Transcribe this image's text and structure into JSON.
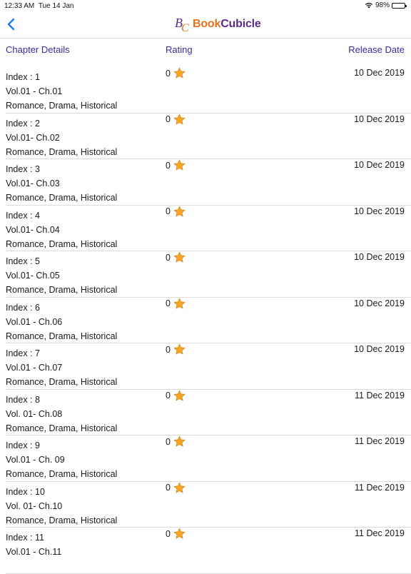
{
  "status_bar": {
    "time": "12:33 AM",
    "date": "Tue 14 Jan",
    "battery": "98%",
    "battery_level": 0.98
  },
  "nav": {
    "back_icon": "chevron-left-icon",
    "logo_mark": "BC",
    "logo_book": "Book",
    "logo_cubicle": "Cubicle"
  },
  "header": {
    "chapter_details": "Chapter Details",
    "rating": "Rating",
    "release_date": "Release Date"
  },
  "colors": {
    "accent": "#3e2aa0",
    "back": "#1a7cf5",
    "logo_orange": "#e8721c",
    "logo_purple": "#5b2b8e",
    "star": "#f6a623"
  },
  "chapters": [
    {
      "index": "Index : 1",
      "volume": "Vol.01 - Ch.01",
      "genres": "Romance, Drama, Historical",
      "rating": "0",
      "date": "10 Dec 2019"
    },
    {
      "index": "Index : 2",
      "volume": "Vol.01- Ch.02",
      "genres": "Romance, Drama, Historical",
      "rating": "0",
      "date": "10 Dec 2019"
    },
    {
      "index": "Index : 3",
      "volume": "Vol.01- Ch.03",
      "genres": "Romance, Drama, Historical",
      "rating": "0",
      "date": "10 Dec 2019"
    },
    {
      "index": "Index : 4",
      "volume": "Vol.01- Ch.04",
      "genres": "Romance, Drama, Historical",
      "rating": "0",
      "date": "10 Dec 2019"
    },
    {
      "index": "Index : 5",
      "volume": "Vol.01- Ch.05",
      "genres": "Romance, Drama, Historical",
      "rating": "0",
      "date": "10 Dec 2019"
    },
    {
      "index": "Index : 6",
      "volume": "Vol.01 - Ch.06",
      "genres": "Romance, Drama, Historical",
      "rating": "0",
      "date": "10 Dec 2019"
    },
    {
      "index": "Index : 7",
      "volume": "Vol.01 - Ch.07",
      "genres": "Romance, Drama, Historical",
      "rating": "0",
      "date": "10 Dec 2019"
    },
    {
      "index": "Index : 8",
      "volume": "Vol. 01-  Ch.08",
      "genres": "Romance, Drama, Historical",
      "rating": "0",
      "date": "11 Dec 2019"
    },
    {
      "index": "Index : 9",
      "volume": "Vol.01 - Ch. 09",
      "genres": "Romance, Drama, Historical",
      "rating": "0",
      "date": "11 Dec 2019"
    },
    {
      "index": "Index : 10",
      "volume": "Vol. 01- Ch.10",
      "genres": "Romance, Drama, Historical",
      "rating": "0",
      "date": "11 Dec 2019"
    },
    {
      "index": "Index : 11",
      "volume": "Vol.01 - Ch.11",
      "genres": "",
      "rating": "0",
      "date": "11 Dec 2019"
    }
  ]
}
